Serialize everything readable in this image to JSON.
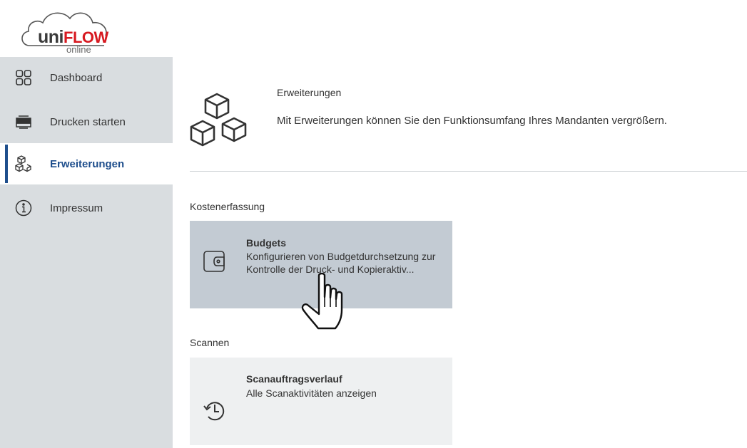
{
  "logo": {
    "brand_uni": "uni",
    "brand_flow": "FLOW",
    "sub": "online",
    "colors": {
      "flow": "#d71920",
      "uni": "#3a3a3a"
    }
  },
  "sidebar": {
    "items": [
      {
        "label": "Dashboard",
        "icon": "dashboard-grid-icon",
        "active": false
      },
      {
        "label": "Drucken starten",
        "icon": "printer-icon",
        "active": false
      },
      {
        "label": "Erweiterungen",
        "icon": "cubes-icon",
        "active": true
      },
      {
        "label": "Impressum",
        "icon": "info-icon",
        "active": false
      }
    ],
    "active_color": "#1e4e8c"
  },
  "main": {
    "hero": {
      "title": "Erweiterungen",
      "description": "Mit Erweiterungen können Sie den Funktionsumfang Ihres Mandanten vergrößern.",
      "icon": "cubes-icon"
    },
    "sections": [
      {
        "title": "Kostenerfassung",
        "cards": [
          {
            "title": "Budgets",
            "description": "Konfigurieren von Budgetdurchsetzung zur Kontrolle der Druck- und Kopieraktiv...",
            "icon": "wallet-icon",
            "hovered": true
          }
        ]
      },
      {
        "title": "Scannen",
        "cards": [
          {
            "title": "Scanauftragsverlauf",
            "description": "Alle Scanaktivitäten anzeigen",
            "icon": "history-icon",
            "hovered": false
          }
        ]
      }
    ]
  },
  "cursor": {
    "icon": "hand-pointer-icon"
  }
}
